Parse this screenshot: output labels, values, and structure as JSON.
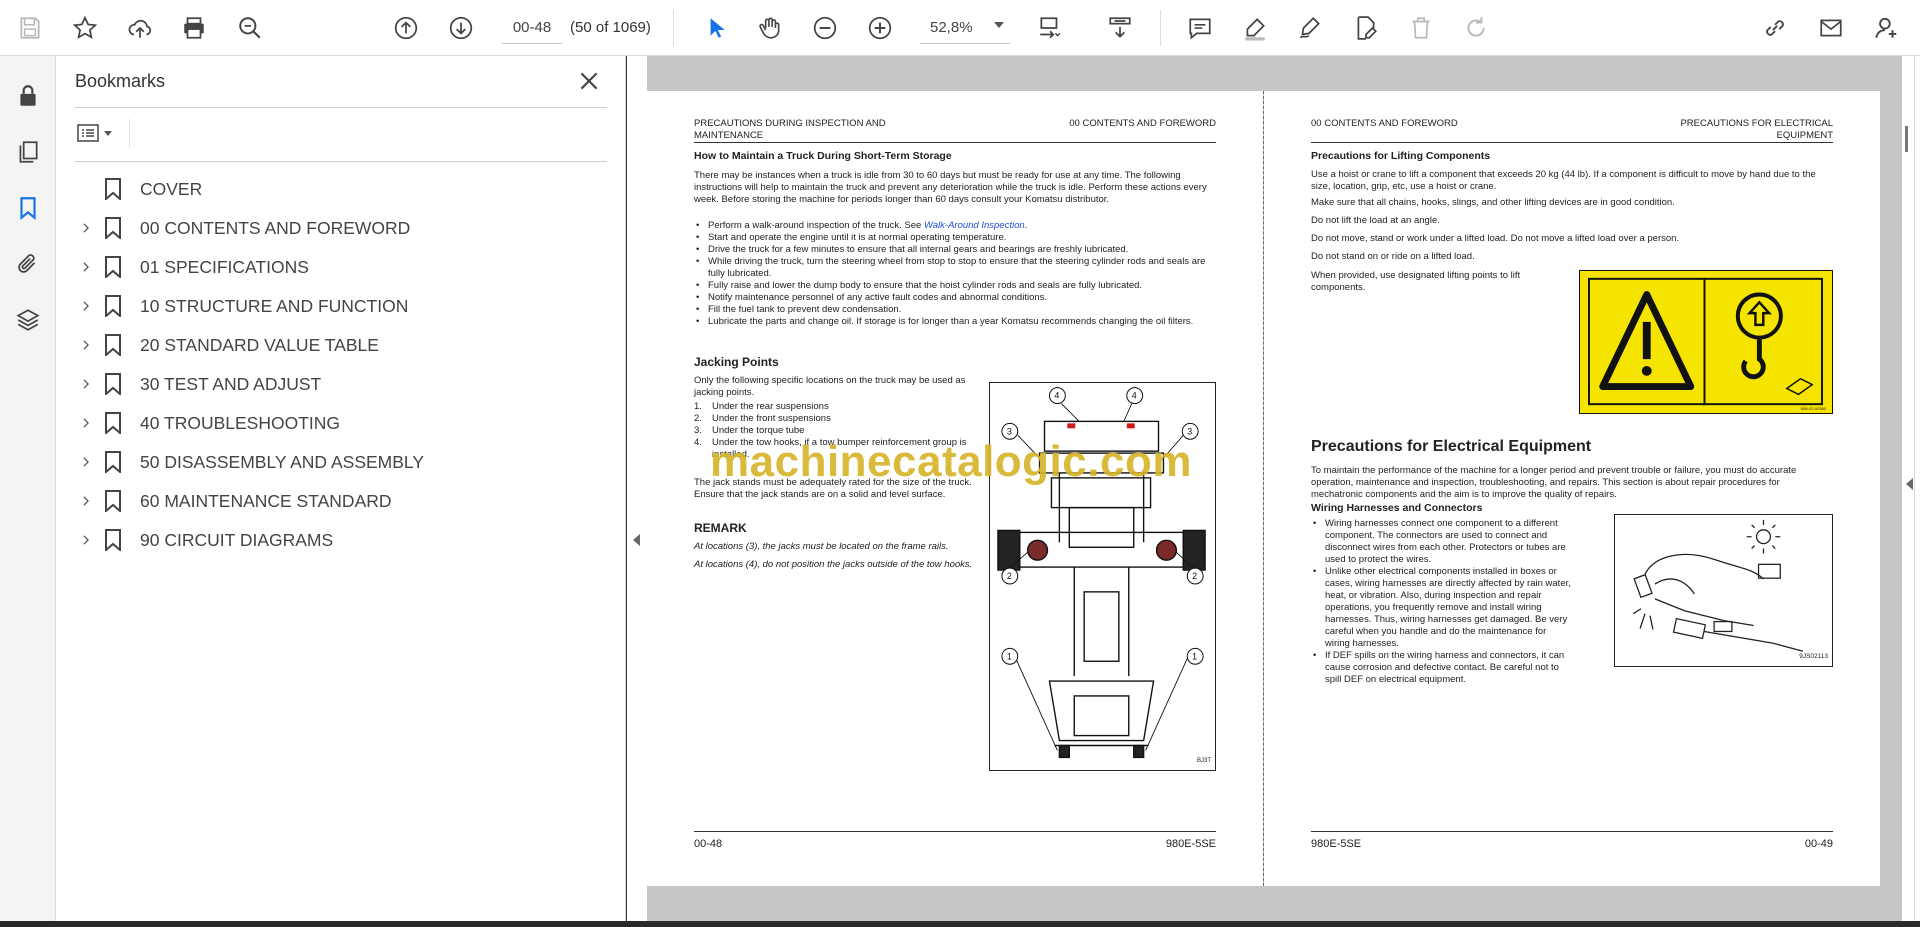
{
  "toolbar": {
    "page_input": "00-48",
    "page_count": "(50 of 1069)",
    "zoom": "52,8%",
    "icons": [
      "save-icon",
      "star-icon",
      "upload-icon",
      "print-icon",
      "zoom-search-icon",
      "page-up-icon",
      "page-down-icon",
      "cursor-icon",
      "hand-icon",
      "zoom-out-icon",
      "zoom-in-icon",
      "fit-page-icon",
      "scroll-mode-icon",
      "comment-icon",
      "highlight-icon",
      "sign-icon",
      "edit-pdf-icon",
      "delete-icon",
      "redo-icon",
      "link-icon",
      "mail-icon",
      "account-icon"
    ]
  },
  "sidebar": {
    "title": "Bookmarks",
    "bookmarks": [
      {
        "label": "COVER",
        "expandable": false
      },
      {
        "label": "00 CONTENTS AND FOREWORD",
        "expandable": true
      },
      {
        "label": "01 SPECIFICATIONS",
        "expandable": true
      },
      {
        "label": "10 STRUCTURE AND FUNCTION",
        "expandable": true
      },
      {
        "label": "20 STANDARD VALUE TABLE",
        "expandable": true
      },
      {
        "label": "30 TEST AND ADJUST",
        "expandable": true
      },
      {
        "label": "40 TROUBLESHOOTING",
        "expandable": true
      },
      {
        "label": "50 DISASSEMBLY AND ASSEMBLY",
        "expandable": true
      },
      {
        "label": "60 MAINTENANCE STANDARD",
        "expandable": true
      },
      {
        "label": "90 CIRCUIT DIAGRAMS",
        "expandable": true
      }
    ]
  },
  "left_page": {
    "header_left_1": "PRECAUTIONS DURING INSPECTION AND",
    "header_left_2": "MAINTENANCE",
    "header_right": "00 CONTENTS AND FOREWORD",
    "h1": "How to Maintain a Truck During Short-Term Storage",
    "intro": "There may be instances when a truck is idle from 30 to 60 days but must be ready for use at any time. The following instructions will help to maintain the truck and prevent any deterioration while the truck is idle. Perform these actions every week. Before storing the machine for periods longer than 60 days consult your Komatsu distributor.",
    "bullets": [
      "Start and operate the engine until it is at normal operating temperature.",
      "Drive the truck for a few minutes to ensure that all internal gears and bearings are freshly lubricated.",
      "While driving the truck, turn the steering wheel from stop to stop to ensure that the steering cylinder rods and seals are fully lubricated.",
      "Fully raise and lower the dump body to ensure that the hoist cylinder rods and seals are fully lubricated.",
      "Notify maintenance personnel of any active fault codes and abnormal conditions.",
      "Fill the fuel tank to prevent dew condensation.",
      "Lubricate the parts and change oil. If storage is for longer than a year Komatsu recommends changing the oil filters."
    ],
    "bullet0_pre": "Perform a walk-around inspection of the truck. See ",
    "bullet0_link": "Walk-Around Inspection",
    "bullet0_post": ".",
    "h2": "Jacking Points",
    "jack_intro": "Only the following specific locations on the truck may be used as jacking points.",
    "jack_list": [
      {
        "n": "1.",
        "t": "Under the rear suspensions"
      },
      {
        "n": "2.",
        "t": "Under the front suspensions"
      },
      {
        "n": "3.",
        "t": "Under the torque tube"
      },
      {
        "n": "4.",
        "t": "Under the tow hooks, if a tow bumper reinforcement group is installed."
      }
    ],
    "jack_note": "The jack stands must be adequately rated for the size of the truck. Ensure that the jack stands are on a solid and level surface.",
    "remark_h": "REMARK",
    "remark_1": "At locations (3), the jacks must be located on the frame rails.",
    "remark_2": "At locations (4), do not position the jacks outside of the tow hooks.",
    "fig_code": "BJ3T",
    "footer_left": "00-48",
    "footer_right": "980E-5SE"
  },
  "right_page": {
    "header_left": "00 CONTENTS AND FOREWORD",
    "header_right_1": "PRECAUTIONS FOR ELECTRICAL",
    "header_right_2": "EQUIPMENT",
    "h1": "Precautions for Lifting Components",
    "p1": "Use a hoist or crane to lift a component that exceeds 20 kg (44 lb). If a component is difficult to move by hand due to the size, location, grip, etc, use a hoist or crane.",
    "p2": "Make sure that all chains, hooks, slings, and other lifting devices are in good condition.",
    "p3": "Do not lift the load at an angle.",
    "p4": "Do not move, stand or work under a lifted load. Do not move a lifted load over a person.",
    "p5": "Do not stand on or ride on a lifted load.",
    "p6": "When provided, use designated lifting points to lift components.",
    "warn_code": "50B-02-00380",
    "big_h": "Precautions for Electrical Equipment",
    "p7": "To maintain the performance of the machine for a longer period and prevent trouble or failure, you must do accurate operation, maintenance and inspection, troubleshooting, and repairs. This section is about repair procedures for mechatronic components and the aim is to improve the quality of repairs.",
    "h2": "Wiring Harnesses and Connectors",
    "bullets": [
      "Wiring harnesses connect one component to a different component. The connectors are used to connect and disconnect wires from each other. Protectors or tubes are used to protect the wires.",
      "Unlike other electrical components installed in boxes or cases, wiring harnesses are directly affected by rain water, heat, or vibration. Also, during inspection and repair operations, you frequently remove and install wiring harnesses. Thus, wiring harnesses get damaged. Be very careful when you handle and do the maintenance for wiring harnesses.",
      "If DEF spills on the wiring harness and connectors, it can cause corrosion and defective contact. Be careful not to spill DEF on electrical equipment."
    ],
    "fig_code": "9JS02113",
    "footer_left": "980E-5SE",
    "footer_right": "00-49"
  },
  "watermark": "machinecatalogic.com"
}
